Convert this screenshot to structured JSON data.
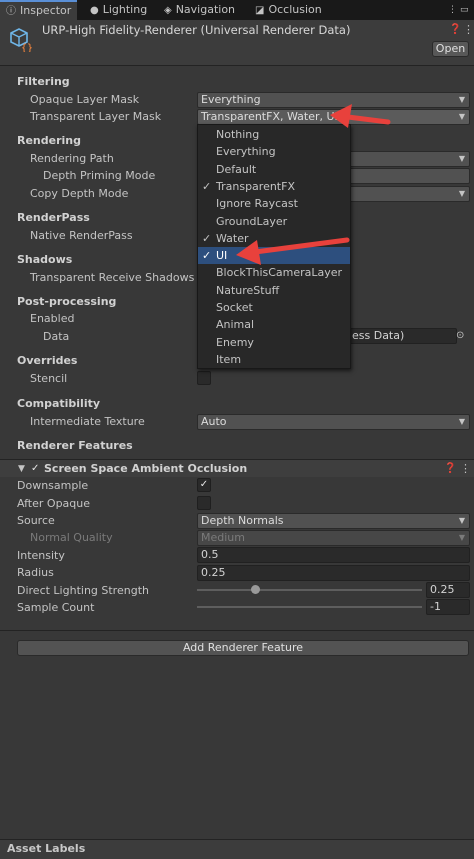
{
  "tabs": [
    {
      "label": "Inspector",
      "icon": "info-icon"
    },
    {
      "label": "Lighting",
      "icon": "lightbulb-icon"
    },
    {
      "label": "Navigation",
      "icon": "navigation-icon"
    },
    {
      "label": "Occlusion",
      "icon": "occlusion-icon"
    }
  ],
  "header": {
    "title": "URP-High Fidelity-Renderer (Universal Renderer Data)",
    "open_label": "Open",
    "help_icon": "help-icon",
    "menu_icon": "kebab-menu-icon"
  },
  "filtering": {
    "section": "Filtering",
    "opaque_label": "Opaque Layer Mask",
    "opaque_value": "Everything",
    "transparent_label": "Transparent Layer Mask",
    "transparent_value": "TransparentFX, Water, UI"
  },
  "rendering": {
    "section": "Rendering",
    "path_label": "Rendering Path",
    "depth_priming_label": "Depth Priming Mode",
    "copy_depth_label": "Copy Depth Mode"
  },
  "renderpass": {
    "section": "RenderPass",
    "native_label": "Native RenderPass"
  },
  "shadows": {
    "section": "Shadows",
    "transparent_receive_label": "Transparent Receive Shadows"
  },
  "postprocessing": {
    "section": "Post-processing",
    "enabled_label": "Enabled",
    "data_label": "Data",
    "data_value": "ess Data)"
  },
  "overrides": {
    "section": "Overrides",
    "stencil_label": "Stencil"
  },
  "compatibility": {
    "section": "Compatibility",
    "intermediate_label": "Intermediate Texture",
    "intermediate_value": "Auto"
  },
  "renderer_features": {
    "section": "Renderer Features",
    "feature_title": "Screen Space Ambient Occlusion",
    "downsample_label": "Downsample",
    "after_opaque_label": "After Opaque",
    "source_label": "Source",
    "source_value": "Depth Normals",
    "normal_quality_label": "Normal Quality",
    "normal_quality_value": "Medium",
    "intensity_label": "Intensity",
    "intensity_value": "0.5",
    "radius_label": "Radius",
    "radius_value": "0.25",
    "direct_label": "Direct Lighting Strength",
    "direct_value": "0.25",
    "sample_label": "Sample Count",
    "sample_value": "-1",
    "add_button": "Add Renderer Feature"
  },
  "popup": {
    "items": [
      {
        "label": "Nothing",
        "checked": false
      },
      {
        "label": "Everything",
        "checked": false
      },
      {
        "label": "Default",
        "checked": false
      },
      {
        "label": "TransparentFX",
        "checked": true
      },
      {
        "label": "Ignore Raycast",
        "checked": false
      },
      {
        "label": "GroundLayer",
        "checked": false
      },
      {
        "label": "Water",
        "checked": true
      },
      {
        "label": "UI",
        "checked": true
      },
      {
        "label": "BlockThisCameraLayer",
        "checked": false
      },
      {
        "label": "NatureStuff",
        "checked": false
      },
      {
        "label": "Socket",
        "checked": false
      },
      {
        "label": "Animal",
        "checked": false
      },
      {
        "label": "Enemy",
        "checked": false
      },
      {
        "label": "Item",
        "checked": false
      }
    ],
    "check_glyph": "✓"
  },
  "footer": {
    "asset_labels": "Asset Labels"
  },
  "colors": {
    "annotation_arrow": "#e8413c",
    "selection": "#2d4f7e"
  }
}
